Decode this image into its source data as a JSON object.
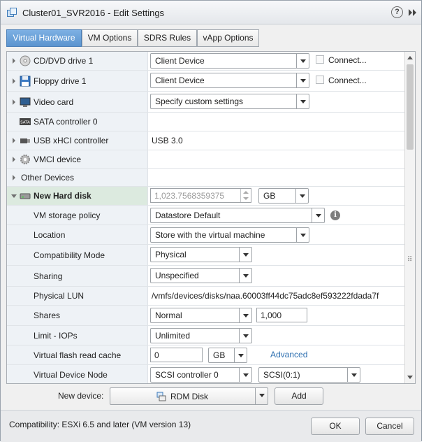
{
  "window": {
    "title": "Cluster01_SVR2016 - Edit Settings",
    "help": "?"
  },
  "tabs": [
    {
      "label": "Virtual Hardware",
      "active": true
    },
    {
      "label": "VM Options",
      "active": false
    },
    {
      "label": "SDRS Rules",
      "active": false
    },
    {
      "label": "vApp Options",
      "active": false
    }
  ],
  "rows": {
    "cddvd": {
      "label": "CD/DVD drive 1",
      "value": "Client Device",
      "connect": "Connect...",
      "icon": "cd-dvd-icon"
    },
    "floppy": {
      "label": "Floppy drive 1",
      "value": "Client Device",
      "connect": "Connect...",
      "icon": "floppy-icon"
    },
    "video": {
      "label": "Video card",
      "value": "Specify custom settings",
      "icon": "monitor-icon"
    },
    "sata": {
      "label": "SATA controller 0",
      "icon": "sata-icon",
      "icon_text": "SATA"
    },
    "usb": {
      "label": "USB xHCI controller",
      "value": "USB 3.0",
      "icon": "usb-icon"
    },
    "vmci": {
      "label": "VMCI device",
      "icon": "gear-icon"
    },
    "other": {
      "label": "Other Devices"
    },
    "harddisk": {
      "label": "New Hard disk",
      "size": "1,023.7568359375",
      "unit": "GB",
      "icon": "hard-disk-icon"
    },
    "storage_policy": {
      "label": "VM storage policy",
      "value": "Datastore Default"
    },
    "location": {
      "label": "Location",
      "value": "Store with the virtual machine"
    },
    "compat_mode": {
      "label": "Compatibility Mode",
      "value": "Physical"
    },
    "sharing": {
      "label": "Sharing",
      "value": "Unspecified"
    },
    "lun": {
      "label": "Physical LUN",
      "value": "/vmfs/devices/disks/naa.60003ff44dc75adc8ef593222fdada7f"
    },
    "shares": {
      "label": "Shares",
      "value": "Normal",
      "amount": "1,000"
    },
    "limit": {
      "label": "Limit - IOPs",
      "value": "Unlimited"
    },
    "flash": {
      "label": "Virtual flash read cache",
      "value": "0",
      "unit": "GB",
      "link": "Advanced"
    },
    "vdn": {
      "label": "Virtual Device Node",
      "controller": "SCSI controller 0",
      "node": "SCSI(0:1)"
    }
  },
  "new_device": {
    "label": "New device:",
    "value": "RDM Disk",
    "add": "Add"
  },
  "footer": {
    "compatibility": "Compatibility: ESXi 6.5 and later (VM version 13)",
    "ok": "OK",
    "cancel": "Cancel"
  },
  "colors": {
    "active_tab": "#5b94cf",
    "highlight_row": "#dceadf",
    "link": "#2d6fb0"
  }
}
